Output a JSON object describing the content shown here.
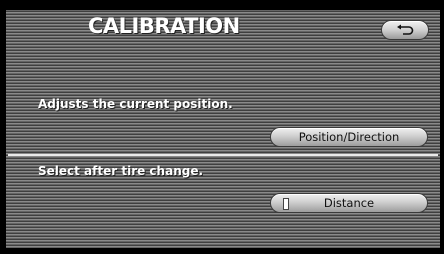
{
  "screen": {
    "title": "CALIBRATION"
  },
  "back_button": {
    "icon": "return-arrow-icon"
  },
  "sections": {
    "position": {
      "description": "Adjusts the current position.",
      "button_label": "Position/Direction"
    },
    "tire": {
      "description": "Select after tire change.",
      "button_label": "Distance"
    }
  },
  "colors": {
    "text": "#ffffff",
    "button_text": "#111111",
    "divider": "#eaeaea"
  }
}
